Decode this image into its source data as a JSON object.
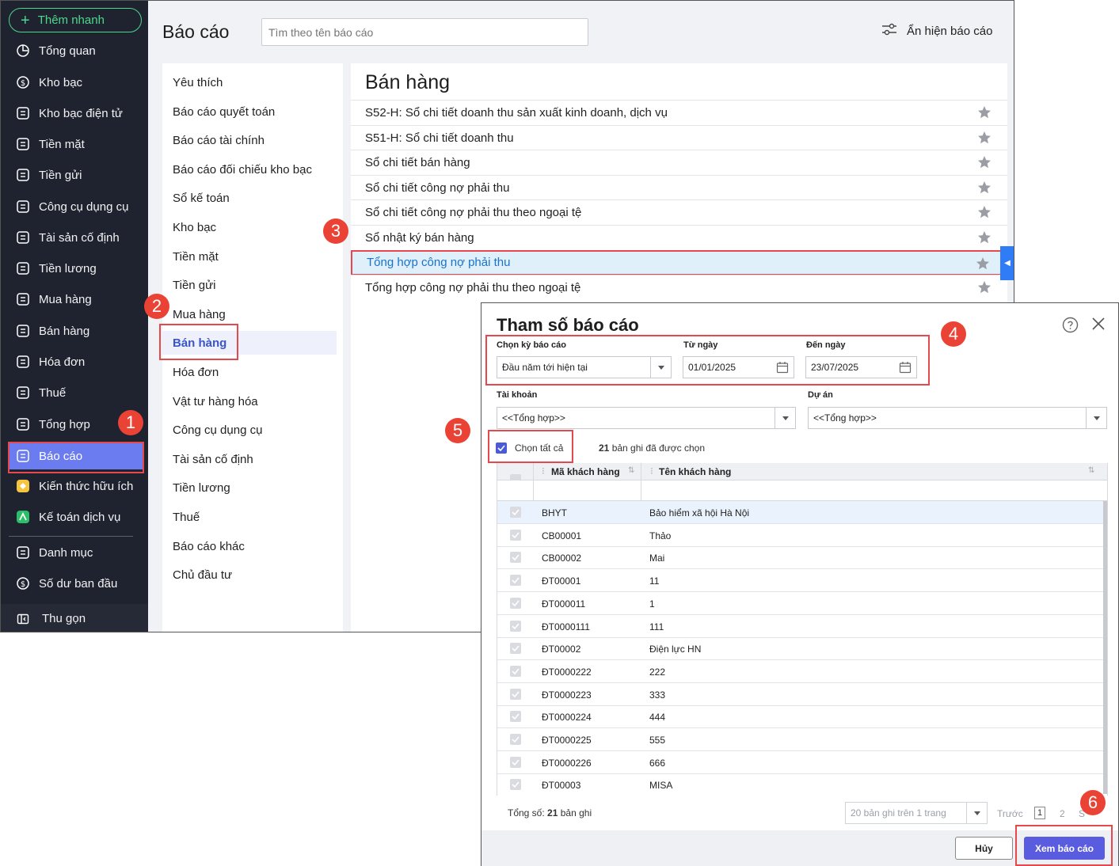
{
  "sidebar": {
    "quick_add": "Thêm nhanh",
    "items": [
      {
        "label": "Tổng quan",
        "icon": "chart-pie-icon"
      },
      {
        "label": "Kho bạc",
        "icon": "coin-icon"
      },
      {
        "label": "Kho bạc điện tử",
        "icon": "digital-money-icon"
      },
      {
        "label": "Tiền mặt",
        "icon": "cash-hand-icon"
      },
      {
        "label": "Tiền gửi",
        "icon": "deposit-icon"
      },
      {
        "label": "Công cụ dụng cụ",
        "icon": "tools-icon"
      },
      {
        "label": "Tài sản cố định",
        "icon": "truck-icon"
      },
      {
        "label": "Tiền lương",
        "icon": "salary-icon"
      },
      {
        "label": "Mua hàng",
        "icon": "cart-icon"
      },
      {
        "label": "Bán hàng",
        "icon": "store-icon"
      },
      {
        "label": "Hóa đơn",
        "icon": "invoice-icon"
      },
      {
        "label": "Thuế",
        "icon": "bank-icon"
      },
      {
        "label": "Tổng hợp",
        "icon": "summary-icon"
      },
      {
        "label": "Báo cáo",
        "icon": "report-icon"
      },
      {
        "label": "Kiến thức hữu ích",
        "icon": "knowledge-icon"
      },
      {
        "label": "Kế toán dịch vụ",
        "icon": "service-icon"
      },
      {
        "label": "Danh mục",
        "icon": "list-icon"
      },
      {
        "label": "Số dư ban đầu",
        "icon": "balance-icon"
      }
    ],
    "collapse": "Thu gọn"
  },
  "header": {
    "title": "Báo cáo",
    "search_placeholder": "Tìm theo tên báo cáo",
    "toggle_reports": "Ẩn hiện báo cáo"
  },
  "categories": [
    "Yêu thích",
    "Báo cáo quyết toán",
    "Báo cáo tài chính",
    "Báo cáo đối chiếu kho bạc",
    "Sổ kế toán",
    "Kho bạc",
    "Tiền mặt",
    "Tiền gửi",
    "Mua hàng",
    "Bán hàng",
    "Hóa đơn",
    "Vật tư hàng hóa",
    "Công cụ dụng cụ",
    "Tài sản cố định",
    "Tiền lương",
    "Thuế",
    "Báo cáo khác",
    "Chủ đầu tư"
  ],
  "reports": {
    "title": "Bán hàng",
    "items": [
      "S52-H: Sổ chi tiết doanh thu sản xuất kinh doanh, dịch vụ",
      "S51-H: Sổ chi tiết doanh thu",
      "Sổ chi tiết bán hàng",
      "Sổ chi tiết công nợ phải thu",
      "Sổ chi tiết công nợ phải thu theo ngoại tệ",
      "Sổ nhật ký bán hàng",
      "Tổng hợp công nợ phải thu",
      "Tổng hợp công nợ phải thu theo ngoại tệ"
    ]
  },
  "badges": [
    "1",
    "2",
    "3",
    "4",
    "5",
    "6"
  ],
  "dialog": {
    "title": "Tham số báo cáo",
    "period_label": "Chọn kỳ báo cáo",
    "period_value": "Đầu năm tới hiện tại",
    "from_label": "Từ ngày",
    "from_value": "01/01/2025",
    "to_label": "Đến ngày",
    "to_value": "23/07/2025",
    "account_label": "Tài khoản",
    "account_value": "<<Tổng hợp>>",
    "project_label": "Dự án",
    "project_value": "<<Tổng hợp>>",
    "select_all": "Chọn tất cả",
    "selected_count": "21",
    "selected_suffix": "bản ghi đã được chọn",
    "col_code": "Mã khách hàng",
    "col_name": "Tên khách hàng",
    "rows": [
      {
        "code": "BHYT",
        "name": "Bảo hiểm xã hội Hà Nội"
      },
      {
        "code": "CB00001",
        "name": "Thảo"
      },
      {
        "code": "CB00002",
        "name": "Mai"
      },
      {
        "code": "ĐT00001",
        "name": "11"
      },
      {
        "code": "ĐT000011",
        "name": "1"
      },
      {
        "code": "ĐT0000111",
        "name": "111"
      },
      {
        "code": "ĐT00002",
        "name": "Điện lực HN"
      },
      {
        "code": "ĐT0000222",
        "name": "222"
      },
      {
        "code": "ĐT0000223",
        "name": "333"
      },
      {
        "code": "ĐT0000224",
        "name": "444"
      },
      {
        "code": "ĐT0000225",
        "name": "555"
      },
      {
        "code": "ĐT0000226",
        "name": "666"
      },
      {
        "code": "ĐT00003",
        "name": "MISA"
      }
    ],
    "total_prefix": "Tổng số:",
    "total_count": "21",
    "total_suffix": "bản ghi",
    "page_size": "20 bản ghi trên 1 trang",
    "prev": "Trước",
    "page_current": "1",
    "page_next": "2",
    "next_cut": "S",
    "cancel": "Hủy",
    "view": "Xem báo cáo"
  },
  "colors": {
    "sidebar_bg": "#1f2330",
    "sidebar_active": "#6b7cf0",
    "accent_green": "#4dd78a",
    "badge_red": "#ea4335",
    "primary_button": "#5a5ce0"
  }
}
